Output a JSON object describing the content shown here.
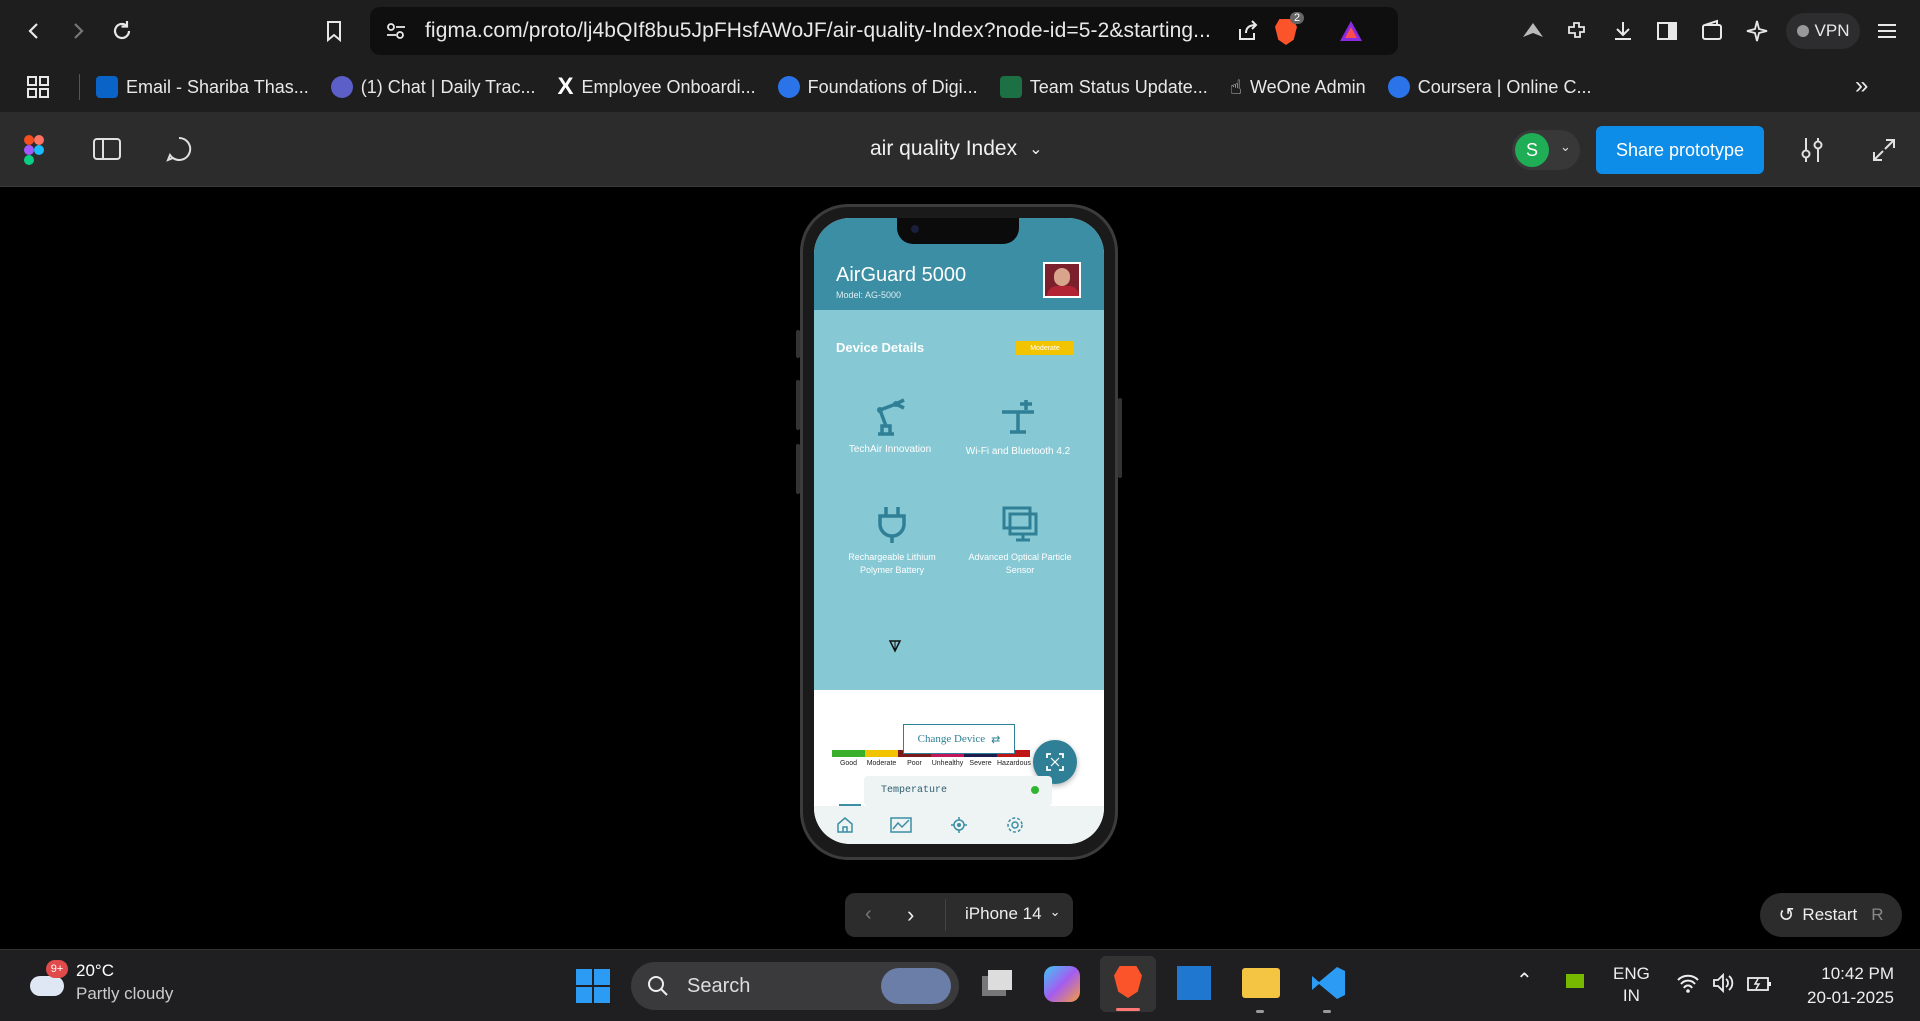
{
  "browser": {
    "url": "figma.com/proto/lj4bQIf8bu5JpFHsfAWoJF/air-quality-Index?node-id=5-2&starting...",
    "brave_badge": "2",
    "vpn_label": "VPN",
    "bookmarks": [
      {
        "label": "Email - Shariba Thas...",
        "color": "#0a64c8"
      },
      {
        "label": "(1) Chat | Daily Trac...",
        "color": "#5b5fc7"
      },
      {
        "label": "Employee Onboardi...",
        "color": "#ffffff"
      },
      {
        "label": "Foundations of Digi...",
        "color": "#2a73e8"
      },
      {
        "label": "Team Status Update...",
        "color": "#1d7044"
      },
      {
        "label": "WeOne Admin",
        "color": "#e8e8e8"
      },
      {
        "label": "Coursera | Online C...",
        "color": "#2a73e8"
      }
    ]
  },
  "figma": {
    "file_title": "air quality Index",
    "avatar_letter": "S",
    "share_label": "Share prototype",
    "device_label": "iPhone 14",
    "restart_label": "Restart",
    "restart_key": "R"
  },
  "app": {
    "title": "AirGuard 5000",
    "model": "Model: AG-5000",
    "section_title": "Device Details",
    "status_badge": "Moderate",
    "tiles": [
      {
        "icon": "robot-arm-icon",
        "label": "TechAir Innovation"
      },
      {
        "icon": "antenna-icon",
        "label": "Wi-Fi and Bluetooth 4.2"
      },
      {
        "icon": "plug-icon",
        "label": "Rechargeable Lithium Polymer Battery"
      },
      {
        "icon": "monitor-icon",
        "label": "Advanced Optical Particle Sensor"
      }
    ],
    "scale": [
      {
        "label": "Good",
        "color": "#3ab02a"
      },
      {
        "label": "Moderate",
        "color": "#f2c400"
      },
      {
        "label": "Poor",
        "color": "#7b1a1a"
      },
      {
        "label": "Unhealthy",
        "color": "#c2185b"
      },
      {
        "label": "Severe",
        "color": "#1d1d4e"
      },
      {
        "label": "Hazardous",
        "color": "#c01515"
      }
    ],
    "change_device_label": "Change Device",
    "temperature_label": "Temperature"
  },
  "taskbar": {
    "weather_temp": "20°C",
    "weather_desc": "Partly cloudy",
    "weather_badge": "9+",
    "search_label": "Search",
    "lang_line1": "ENG",
    "lang_line2": "IN",
    "time": "10:42 PM",
    "date": "20-01-2025"
  }
}
